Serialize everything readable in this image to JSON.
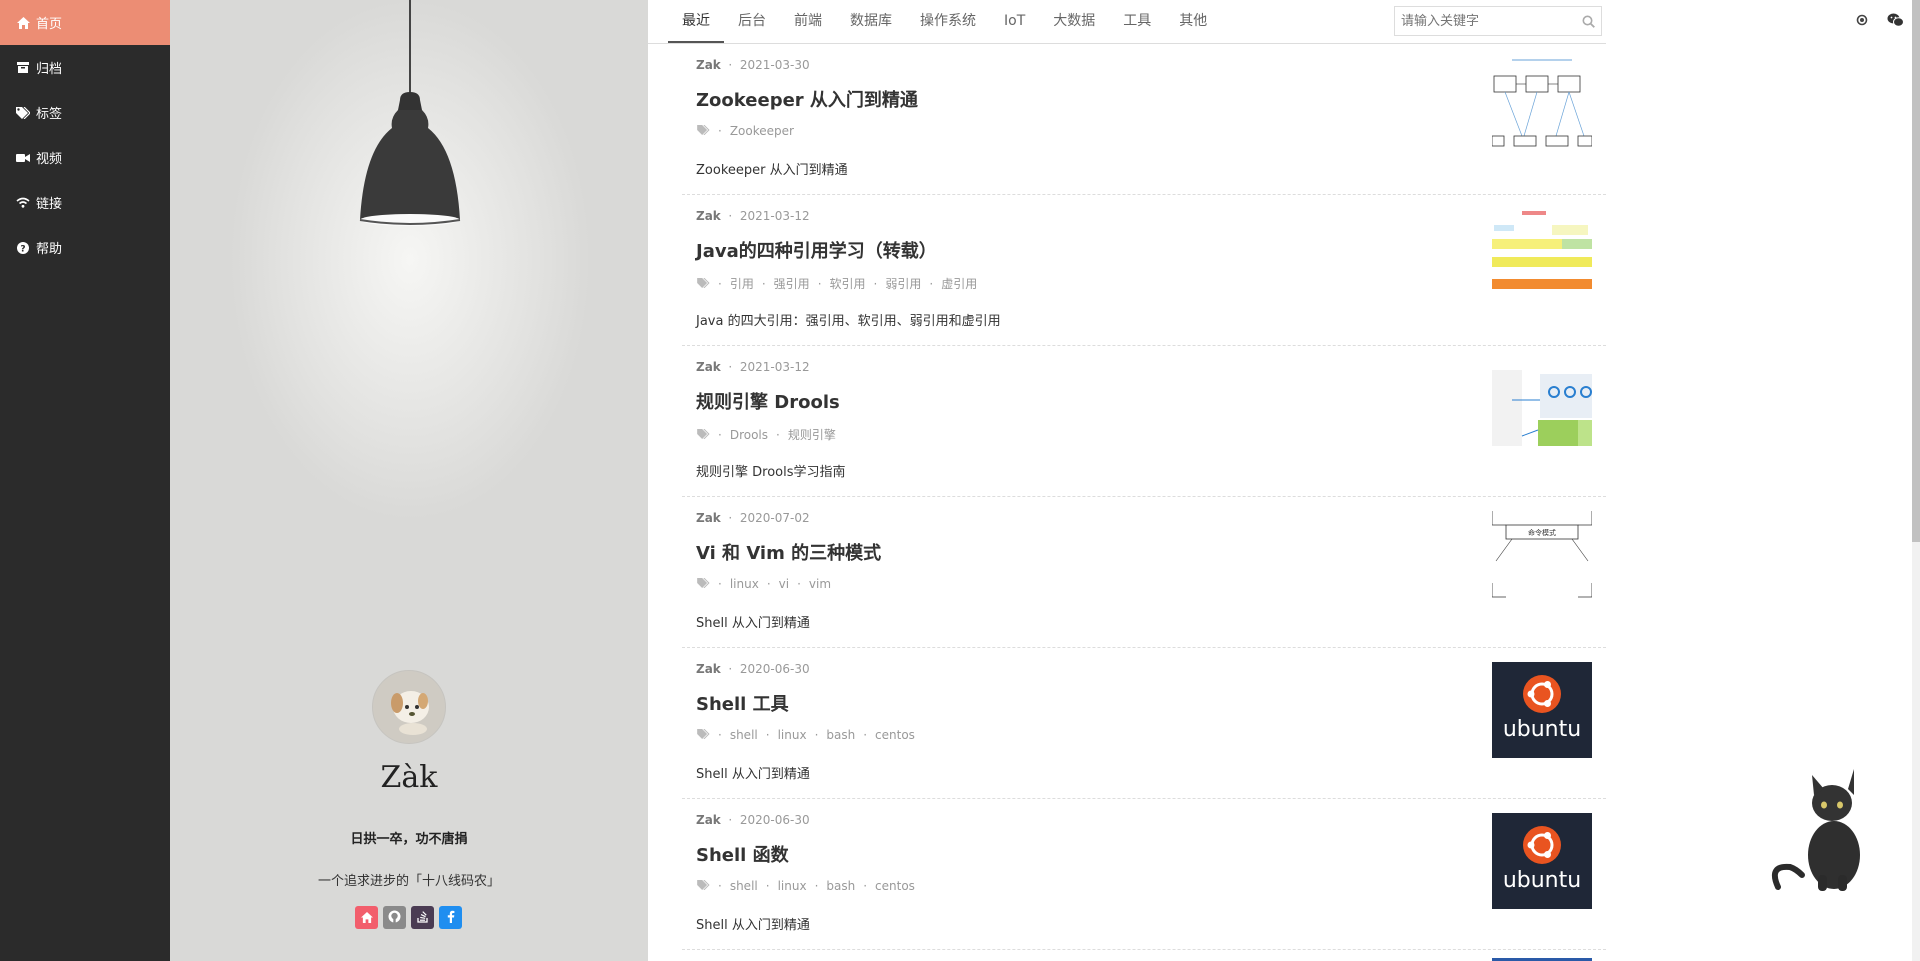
{
  "sidebar": {
    "items": [
      {
        "label": "首页",
        "icon": "home-icon",
        "active": true
      },
      {
        "label": "归档",
        "icon": "archive-icon"
      },
      {
        "label": "标签",
        "icon": "tags-icon"
      },
      {
        "label": "视频",
        "icon": "video-icon"
      },
      {
        "label": "链接",
        "icon": "wifi-icon"
      },
      {
        "label": "帮助",
        "icon": "question-icon"
      }
    ]
  },
  "profile": {
    "name": "Zàk",
    "motto": "日拱一卒，功不唐捐",
    "desc": "一个追求进步的「十八线码农」",
    "socials": [
      {
        "icon": "home-icon",
        "color": "#f25e6c"
      },
      {
        "icon": "github-icon",
        "color": "#8a8a8a"
      },
      {
        "icon": "stackoverflow-icon",
        "color": "#4b3c53"
      },
      {
        "icon": "facebook-icon",
        "color": "#1f8ef0"
      }
    ]
  },
  "topnav": {
    "tabs": [
      "最近",
      "后台",
      "前端",
      "数据库",
      "操作系统",
      "IoT",
      "大数据",
      "工具",
      "其他"
    ],
    "active_tab": "最近",
    "search_placeholder": "请输入关键字"
  },
  "posts": [
    {
      "author": "Zak",
      "date": "2021-03-30",
      "title": "Zookeeper 从入门到精通",
      "tags": [
        "Zookeeper"
      ],
      "summary": "Zookeeper 从入门到精通",
      "thumb": "zookeeper-diagram"
    },
    {
      "author": "Zak",
      "date": "2021-03-12",
      "title": "Java的四种引用学习（转载）",
      "tags": [
        "引用",
        "强引用",
        "软引用",
        "弱引用",
        "虚引用"
      ],
      "summary": "Java 的四大引用：强引用、软引用、弱引用和虚引用",
      "thumb": "gc-diagram"
    },
    {
      "author": "Zak",
      "date": "2021-03-12",
      "title": "规则引擎 Drools",
      "tags": [
        "Drools",
        "规则引擎"
      ],
      "summary": "规则引擎 Drools学习指南",
      "thumb": "drools-diagram"
    },
    {
      "author": "Zak",
      "date": "2020-07-02",
      "title": "Vi 和 Vim 的三种模式",
      "tags": [
        "linux",
        "vi",
        "vim"
      ],
      "summary": "Shell 从入门到精通",
      "thumb": "vim-modes-diagram"
    },
    {
      "author": "Zak",
      "date": "2020-06-30",
      "title": "Shell 工具",
      "tags": [
        "shell",
        "linux",
        "bash",
        "centos"
      ],
      "summary": "Shell 从入门到精通",
      "thumb": "ubuntu-logo"
    },
    {
      "author": "Zak",
      "date": "2020-06-30",
      "title": "Shell 函数",
      "tags": [
        "shell",
        "linux",
        "bash",
        "centos"
      ],
      "summary": "Shell 从入门到精通",
      "thumb": "ubuntu-logo"
    }
  ],
  "thumb_text": {
    "vim_mode_label": "命令模式",
    "ubuntu_wordmark": "ubuntu"
  },
  "right_rail": {
    "icons": [
      "brightness-icon",
      "wechat-icon"
    ]
  },
  "colors": {
    "active_nav": "#ec8d74",
    "sidebar_bg": "#2b2b2b",
    "ubuntu_orange": "#e95420",
    "ubuntu_bg": "#1f2737"
  }
}
